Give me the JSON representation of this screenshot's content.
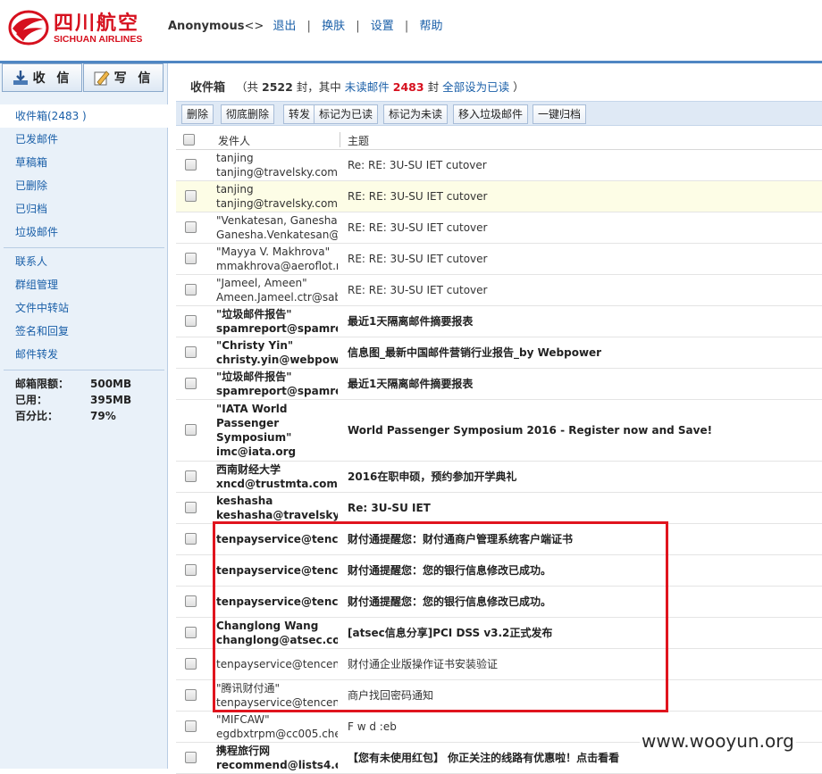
{
  "brand": {
    "name_cn": "四川航空",
    "name_en": "SICHUAN AIRLINES",
    "color": "#d6101e"
  },
  "topnav": {
    "user": "Anonymous",
    "user_suffix": "<>",
    "logout": "退出",
    "skin": "换肤",
    "settings": "设置",
    "help": "帮助"
  },
  "sidebar": {
    "receive_label": "收 信",
    "write_label": "写 信",
    "folders": [
      "收件箱(2483 )",
      "已发邮件",
      "草稿箱",
      "已删除",
      "已归档",
      "垃圾邮件"
    ],
    "tools": [
      "联系人",
      "群组管理",
      "文件中转站",
      "签名和回复",
      "邮件转发"
    ],
    "quota": {
      "limit_label": "邮箱限额：",
      "limit_value": "500MB",
      "used_label": "已用：",
      "used_value": "395MB",
      "percent_label": "百分比：",
      "percent_value": "79%"
    }
  },
  "inbox": {
    "title": "收件箱",
    "open_paren": "（共",
    "total": "2522",
    "unit1": "封，其中",
    "unread_link": "未读邮件",
    "unread_count": "2483",
    "unit2": "封",
    "mark_all_read": "全部设为已读",
    "close_paren": "）"
  },
  "toolbar": [
    "删除",
    "彻底删除",
    "转发",
    "标记为已读",
    "标记为未读",
    "移入垃圾邮件",
    "一键归档"
  ],
  "columns": {
    "sender": "发件人",
    "subject": "主题"
  },
  "emails": [
    {
      "sender": [
        "tanjing",
        "tanjing@travelsky.com"
      ],
      "subject": "Re: RE: 3U-SU IET cutover",
      "bold": false,
      "highlight": false
    },
    {
      "sender": [
        "tanjing",
        "tanjing@travelsky.com"
      ],
      "subject": "RE: RE: 3U-SU IET cutover",
      "bold": false,
      "highlight": true
    },
    {
      "sender": [
        "\"Venkatesan, Ganesha\"",
        "Ganesha.Venkatesan@s"
      ],
      "subject": "RE: RE: 3U-SU IET cutover",
      "bold": false,
      "highlight": false
    },
    {
      "sender": [
        "\"Mayya V. Makhrova\"",
        "mmakhrova@aeroflot.r"
      ],
      "subject": "RE: RE: 3U-SU IET cutover",
      "bold": false,
      "highlight": false
    },
    {
      "sender": [
        "\"Jameel, Ameen\"",
        "Ameen.Jameel.ctr@sab"
      ],
      "subject": "RE: RE: 3U-SU IET cutover",
      "bold": false,
      "highlight": false
    },
    {
      "sender": [
        "\"垃圾邮件报告\"",
        "spamreport@spamrep"
      ],
      "subject": "最近1天隔离邮件摘要报表",
      "bold": true,
      "highlight": false
    },
    {
      "sender": [
        "\"Christy Yin\"",
        "christy.yin@webpower"
      ],
      "subject": "信息图_最新中国邮件营销行业报告_by Webpower",
      "bold": true,
      "highlight": false
    },
    {
      "sender": [
        "\"垃圾邮件报告\"",
        "spamreport@spamrep"
      ],
      "subject": "最近1天隔离邮件摘要报表",
      "bold": true,
      "highlight": false
    },
    {
      "sender": [
        "\"IATA World",
        "Passenger",
        "Symposium\"",
        "imc@iata.org"
      ],
      "subject": "World Passenger Symposium 2016 - Register now and Save!",
      "bold": true,
      "highlight": false
    },
    {
      "sender": [
        "西南财经大学",
        "xncd@trustmta.com"
      ],
      "subject": "2016在职申硕，预约参加开学典礼",
      "bold": true,
      "highlight": false
    },
    {
      "sender": [
        "keshasha",
        "keshasha@travelsky.co"
      ],
      "subject": "Re: 3U-SU IET",
      "bold": true,
      "highlight": false
    },
    {
      "sender": [
        "tenpayservice@tencen"
      ],
      "subject": "财付通提醒您：财付通商户管理系统客户端证书",
      "bold": true,
      "highlight": false
    },
    {
      "sender": [
        "tenpayservice@tencen"
      ],
      "subject": "财付通提醒您：您的银行信息修改已成功。",
      "bold": true,
      "highlight": false
    },
    {
      "sender": [
        "tenpayservice@tencen"
      ],
      "subject": "财付通提醒您：您的银行信息修改已成功。",
      "bold": true,
      "highlight": false
    },
    {
      "sender": [
        "Changlong Wang",
        "changlong@atsec.com"
      ],
      "subject": "[atsec信息分享]PCI DSS v3.2正式发布",
      "bold": true,
      "highlight": false
    },
    {
      "sender": [
        "tenpayservice@tencent."
      ],
      "subject": "财付通企业版操作证书安装验证",
      "bold": false,
      "highlight": false
    },
    {
      "sender": [
        "\"腾讯财付通\"",
        "tenpayservice@tencent."
      ],
      "subject": "商户找回密码通知",
      "bold": false,
      "highlight": false
    },
    {
      "sender": [
        "\"MIFCAW\"",
        "egdbxtrpm@cc005.che"
      ],
      "subject": "F w d :eb",
      "bold": false,
      "highlight": false
    },
    {
      "sender": [
        "携程旅行网",
        "recommend@lists4.ctr"
      ],
      "subject": "【您有未使用红包】 你正关注的线路有优惠啦！点击看看",
      "bold": true,
      "highlight": false
    }
  ],
  "watermark": "www.wooyun.org"
}
